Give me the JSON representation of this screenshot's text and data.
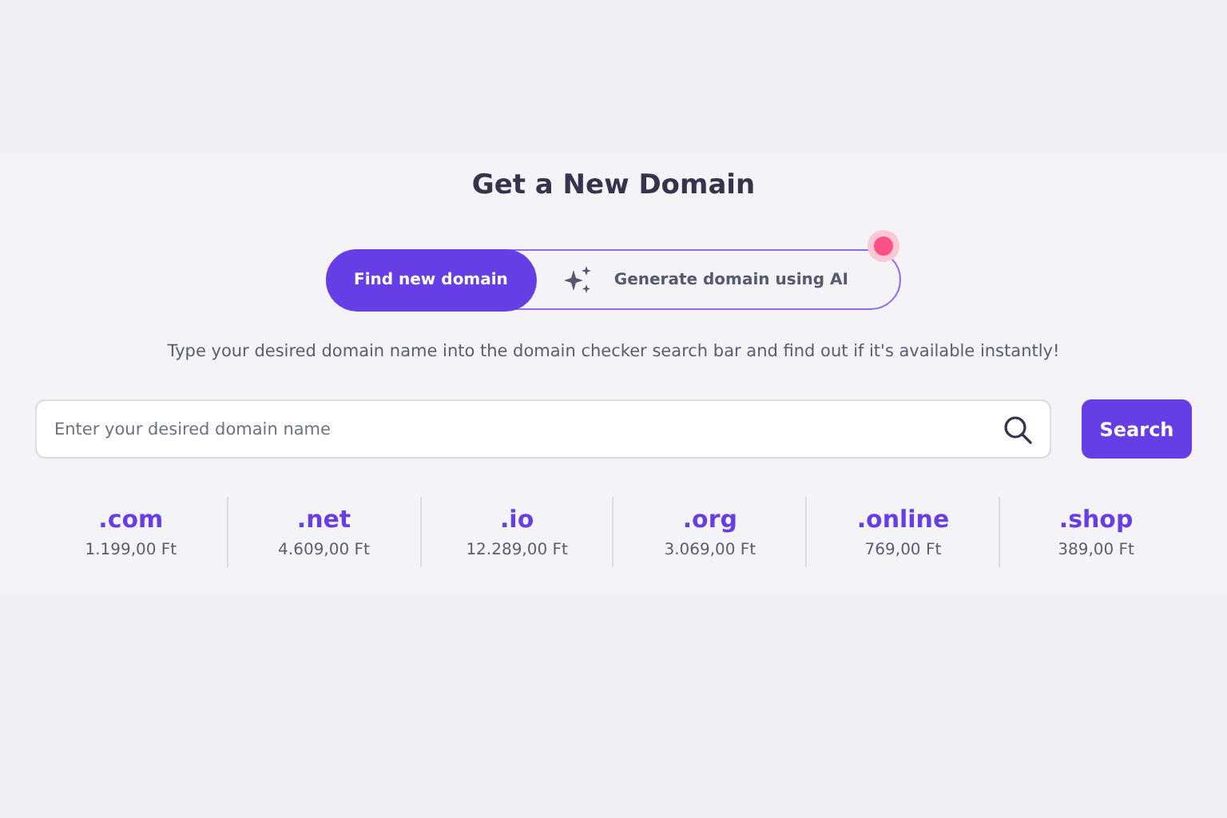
{
  "title": "Get a New Domain",
  "tabs": [
    {
      "label": "Find new domain",
      "selected": true,
      "kind": "plain"
    },
    {
      "label": "Generate domain using AI",
      "selected": false,
      "kind": "ai"
    }
  ],
  "description": "Type your desired domain name into the domain checker search bar and find out if it's available instantly!",
  "search": {
    "placeholder": "Enter your desired domain name",
    "button": "Search"
  },
  "tlds": [
    {
      "name": ".com",
      "price": "1.199,00 Ft"
    },
    {
      "name": ".net",
      "price": "4.609,00 Ft"
    },
    {
      "name": ".io",
      "price": "12.289,00 Ft"
    },
    {
      "name": ".org",
      "price": "3.069,00 Ft"
    },
    {
      "name": ".online",
      "price": "769,00 Ft"
    },
    {
      "name": ".shop",
      "price": "389,00 Ft"
    }
  ]
}
